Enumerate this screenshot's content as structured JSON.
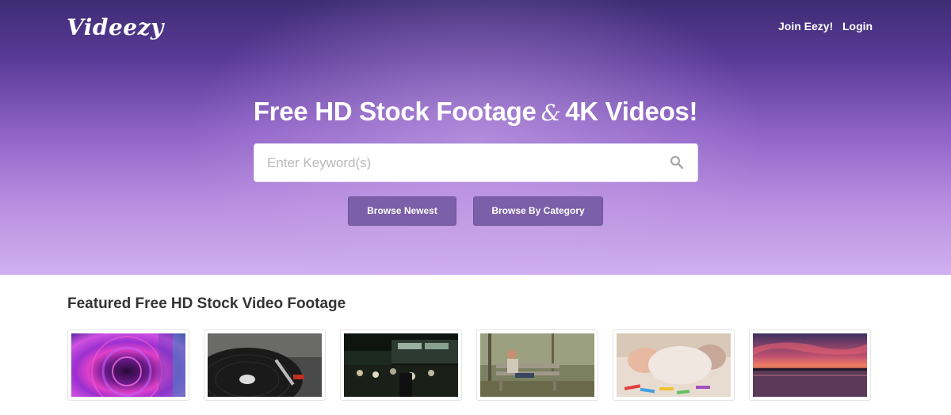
{
  "header": {
    "logo_text": "Videezy",
    "nav": {
      "join_label": "Join Eezy!",
      "login_label": "Login"
    }
  },
  "hero": {
    "headline_part1": "Free HD Stock Footage",
    "headline_amp": "&",
    "headline_part2": "4K Videos!",
    "search": {
      "placeholder": "Enter Keyword(s)",
      "value": "",
      "icon": "search-icon"
    },
    "buttons": {
      "newest_label": "Browse Newest",
      "category_label": "Browse By Category"
    }
  },
  "featured": {
    "title": "Featured Free HD Stock Video Footage",
    "thumbnails": [
      {
        "subject": "abstract purple light rings"
      },
      {
        "subject": "vinyl record turntable"
      },
      {
        "subject": "night city crowd"
      },
      {
        "subject": "woman sitting on park bench"
      },
      {
        "subject": "child with crayons"
      },
      {
        "subject": "sunset over lake"
      }
    ]
  },
  "colors": {
    "hero_top": "#3e2c74",
    "hero_bottom": "#d2b0ef",
    "button_bg": "#7b5fa8",
    "title_text": "#333333"
  }
}
